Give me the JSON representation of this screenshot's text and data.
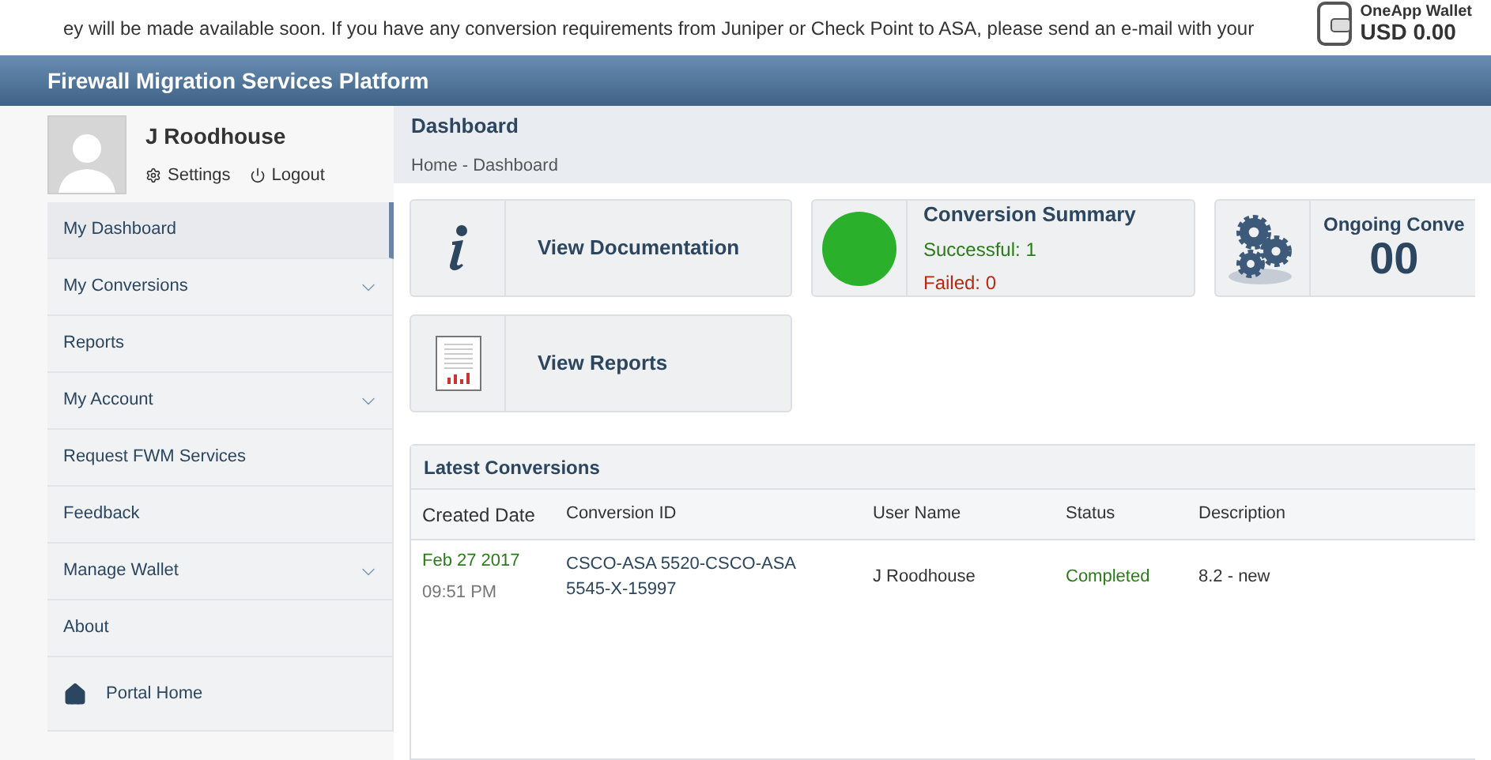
{
  "notice": {
    "text": "ey will be made available soon. If you have any conversion requirements from Juniper or Check Point to ASA, please send an e-mail with your"
  },
  "wallet": {
    "label": "OneApp Wallet",
    "balance": "USD 0.00"
  },
  "header": {
    "title": "Firewall Migration Services Platform"
  },
  "user": {
    "name": "J Roodhouse",
    "links": [
      "Settings",
      "Logout"
    ]
  },
  "sidebar": {
    "items": [
      {
        "label": "My Dashboard",
        "selected": true,
        "has_submenu": false
      },
      {
        "label": "My Conversions",
        "selected": false,
        "has_submenu": true
      },
      {
        "label": "Reports",
        "selected": false,
        "has_submenu": false
      },
      {
        "label": "My Account",
        "selected": false,
        "has_submenu": true
      },
      {
        "label": "Request FWM Services",
        "selected": false,
        "has_submenu": false
      },
      {
        "label": "Feedback",
        "selected": false,
        "has_submenu": false
      },
      {
        "label": "Manage Wallet",
        "selected": false,
        "has_submenu": true
      },
      {
        "label": "About",
        "selected": false,
        "has_submenu": false
      }
    ],
    "portal_home": "Portal Home"
  },
  "page": {
    "title": "Dashboard",
    "breadcrumb": "Home - Dashboard"
  },
  "cards": {
    "documentation": "View Documentation",
    "reports": "View Reports",
    "summary": {
      "title": "Conversion Summary",
      "successful": "Successful: 1",
      "failed": "Failed: 0"
    },
    "ongoing": {
      "title": "Ongoing Conve",
      "count": "00"
    }
  },
  "latest": {
    "title": "Latest Conversions",
    "columns": [
      "Created Date",
      "Conversion ID",
      "User Name",
      "Status",
      "Description"
    ],
    "rows": [
      {
        "date": "Feb 27 2017",
        "time": "09:51 PM",
        "id": "CSCO-ASA 5520-CSCO-ASA 5545-X-15997",
        "user": "J Roodhouse",
        "status": "Completed",
        "description": "8.2 - new"
      }
    ]
  }
}
